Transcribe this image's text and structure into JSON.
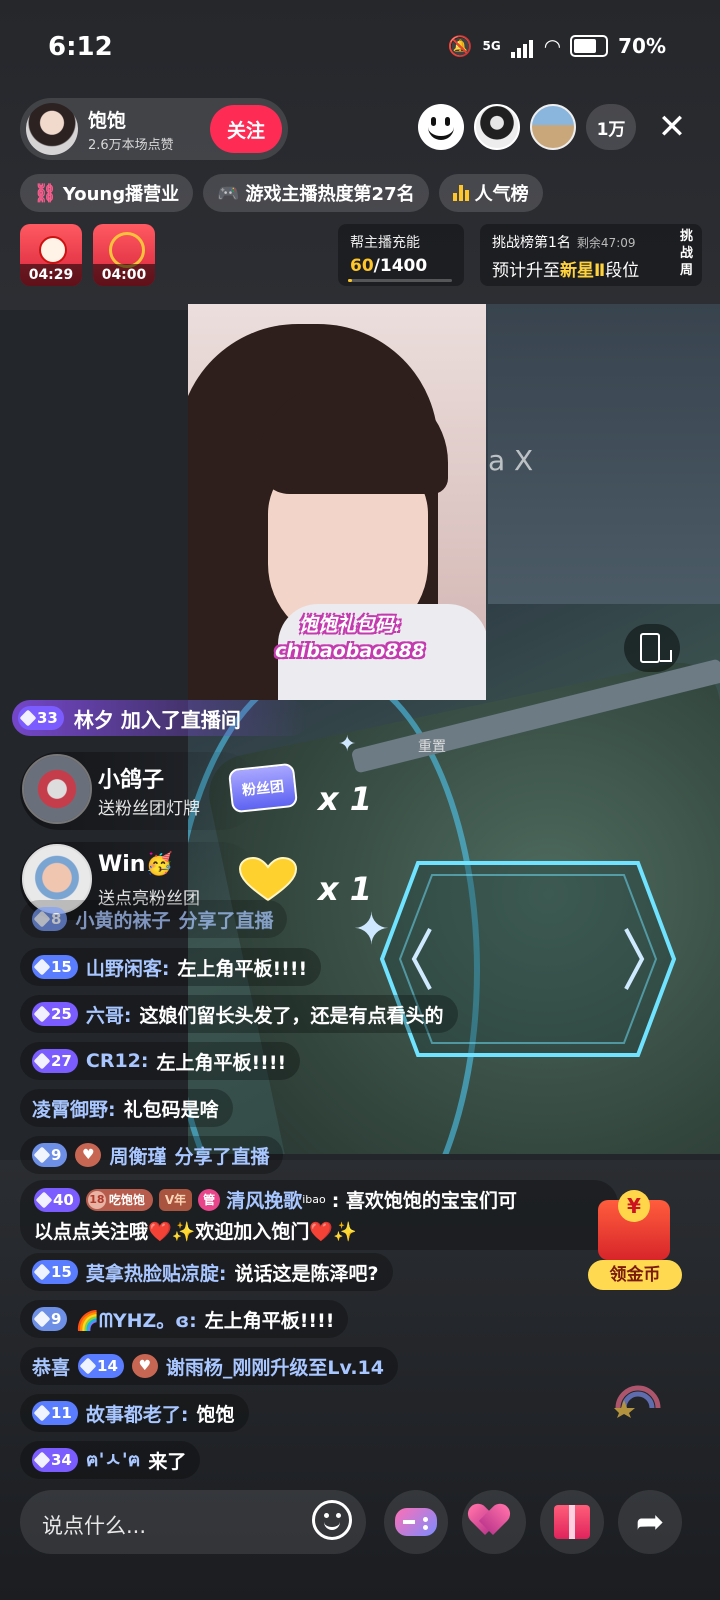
{
  "status_bar": {
    "time": "6:12",
    "network": "5G",
    "battery": "70%"
  },
  "anchor": {
    "name": "饱饱",
    "likes": "2.6万本场点赞",
    "follow_label": "关注"
  },
  "viewers": {
    "count": "1万"
  },
  "tags": [
    {
      "icon": "link-icon",
      "label": "Young播营业"
    },
    {
      "icon": "gamepad-icon",
      "label": "游戏主播热度第27名"
    },
    {
      "icon": "bar-chart-icon",
      "label": "人气榜"
    }
  ],
  "envelopes": [
    {
      "timer": "04:29"
    },
    {
      "timer": "04:00"
    }
  ],
  "charge": {
    "label": "帮主播充能",
    "current": "60",
    "total": "/1400",
    "progress": 0.043
  },
  "rank": {
    "title": "挑战榜第1名",
    "remaining": "剩余47:09",
    "line_prefix": "预计升至",
    "highlight": "新星Ⅱ",
    "line_suffix": "段位",
    "week_label": "挑战周"
  },
  "video": {
    "cam_text_line1": "饱饱礼包码:",
    "cam_text_line2": "chibaobao888",
    "overlay_text": "a X",
    "small_label": "重置"
  },
  "enter_banner": {
    "level": "33",
    "text": "林夕 加入了直播间"
  },
  "gifts": [
    {
      "name": "小鸽子",
      "desc": "送粉丝团灯牌",
      "gift_label": "粉丝团",
      "count": "x 1"
    },
    {
      "name": "Win🥳",
      "desc": "送点亮粉丝团",
      "count": "x 1"
    }
  ],
  "chat": [
    {
      "level": "8",
      "name": "小黄的袜子",
      "text": "分享了直播"
    },
    {
      "level": "15",
      "name": "山野闲客:",
      "text": "左上角平板!!!!"
    },
    {
      "level": "25",
      "name": "六哥:",
      "text": "这娘们留长头发了，还是有点看头的"
    },
    {
      "level": "27",
      "name": "CR12:",
      "text": "左上角平板!!!!"
    },
    {
      "name": "凌霄御野:",
      "text": "礼包码是啥"
    },
    {
      "level": "9",
      "name": "周衡瑾",
      "text": "分享了直播"
    },
    {
      "level": "40",
      "fan_level": "18",
      "fan_name": "吃饱饱",
      "vip": "V年",
      "admin": "管",
      "name": "清风挽歌",
      "sup": "ibao",
      "text1": ": 喜欢饱饱的宝宝们可",
      "text2": "以点点关注哦❤️✨欢迎加入饱门❤️✨"
    },
    {
      "level": "15",
      "name": "莫拿热脸贴凉腚:",
      "text": "说话这是陈泽吧?"
    },
    {
      "level": "9",
      "name": "🌈ᗰYHZ。ɞ:",
      "text": "左上角平板!!!!"
    },
    {
      "prefix": "恭喜",
      "level": "14",
      "name": "谢雨杨_刚刚升级至Lv.14"
    },
    {
      "level": "11",
      "name": "故事都老了:",
      "text": "饱饱"
    },
    {
      "level": "34",
      "name": "ฅ'ㅅ'ฅ",
      "text": "来了"
    }
  ],
  "coin": {
    "label": "领金币"
  },
  "bottom": {
    "input_placeholder": "说点什么..."
  }
}
